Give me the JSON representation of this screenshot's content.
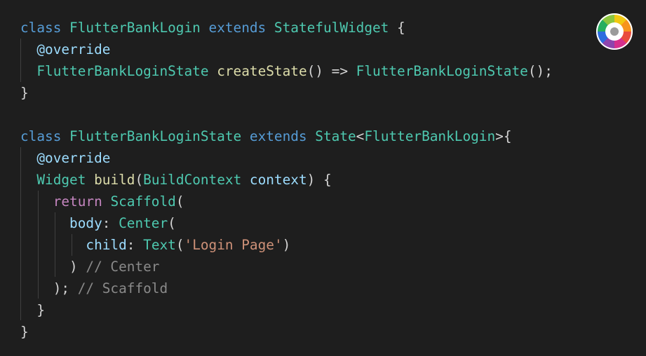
{
  "code_lines": [
    [
      {
        "t": "class ",
        "c": "kw"
      },
      {
        "t": "FlutterBankLogin ",
        "c": "ty"
      },
      {
        "t": "extends ",
        "c": "kw"
      },
      {
        "t": "StatefulWidget ",
        "c": "ty"
      },
      {
        "t": "{",
        "c": "punc"
      }
    ],
    [
      {
        "t": "  ",
        "c": "punc"
      },
      {
        "t": "@override",
        "c": "var"
      }
    ],
    [
      {
        "t": "  ",
        "c": "punc"
      },
      {
        "t": "FlutterBankLoginState ",
        "c": "ty"
      },
      {
        "t": "createState",
        "c": "fn"
      },
      {
        "t": "() => ",
        "c": "punc"
      },
      {
        "t": "FlutterBankLoginState",
        "c": "ty"
      },
      {
        "t": "();",
        "c": "punc"
      }
    ],
    [
      {
        "t": "}",
        "c": "punc"
      }
    ],
    [],
    [
      {
        "t": "class ",
        "c": "kw"
      },
      {
        "t": "FlutterBankLoginState ",
        "c": "ty"
      },
      {
        "t": "extends ",
        "c": "kw"
      },
      {
        "t": "State",
        "c": "ty"
      },
      {
        "t": "<",
        "c": "punc"
      },
      {
        "t": "FlutterBankLogin",
        "c": "ty"
      },
      {
        "t": ">{",
        "c": "punc"
      }
    ],
    [
      {
        "t": "  ",
        "c": "punc"
      },
      {
        "t": "@override",
        "c": "var"
      }
    ],
    [
      {
        "t": "  ",
        "c": "punc"
      },
      {
        "t": "Widget ",
        "c": "ty"
      },
      {
        "t": "build",
        "c": "fn"
      },
      {
        "t": "(",
        "c": "punc"
      },
      {
        "t": "BuildContext ",
        "c": "ty"
      },
      {
        "t": "context",
        "c": "var"
      },
      {
        "t": ") {",
        "c": "punc"
      }
    ],
    [
      {
        "t": "    ",
        "c": "punc"
      },
      {
        "t": "return ",
        "c": "ctl"
      },
      {
        "t": "Scaffold",
        "c": "ty"
      },
      {
        "t": "(",
        "c": "punc"
      }
    ],
    [
      {
        "t": "      ",
        "c": "punc"
      },
      {
        "t": "body",
        "c": "var"
      },
      {
        "t": ": ",
        "c": "punc"
      },
      {
        "t": "Center",
        "c": "ty"
      },
      {
        "t": "(",
        "c": "punc"
      }
    ],
    [
      {
        "t": "        ",
        "c": "punc"
      },
      {
        "t": "child",
        "c": "var"
      },
      {
        "t": ": ",
        "c": "punc"
      },
      {
        "t": "Text",
        "c": "ty"
      },
      {
        "t": "(",
        "c": "punc"
      },
      {
        "t": "'Login Page'",
        "c": "str"
      },
      {
        "t": ")",
        "c": "punc"
      }
    ],
    [
      {
        "t": "      ",
        "c": "punc"
      },
      {
        "t": ") ",
        "c": "punc"
      },
      {
        "t": "// Center",
        "c": "cm muted"
      }
    ],
    [
      {
        "t": "    ",
        "c": "punc"
      },
      {
        "t": "); ",
        "c": "punc"
      },
      {
        "t": "// Scaffold",
        "c": "cm muted"
      }
    ],
    [
      {
        "t": "  ",
        "c": "punc"
      },
      {
        "t": "}",
        "c": "punc"
      }
    ],
    [
      {
        "t": "}",
        "c": "punc"
      }
    ]
  ],
  "logo": {
    "icon": "color-wheel-icon"
  },
  "colors": {
    "background": "#1e1e1e",
    "keyword": "#569cd6",
    "control": "#c586c0",
    "type": "#4ec9b0",
    "function": "#dcdcaa",
    "variable": "#9cdcfe",
    "string": "#ce9178",
    "comment": "#8a8a8a"
  }
}
